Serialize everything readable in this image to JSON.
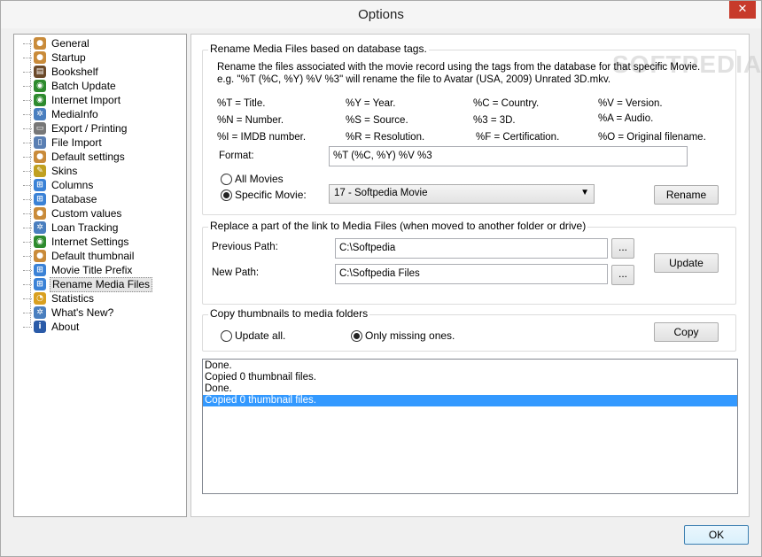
{
  "window": {
    "title": "Options",
    "close_glyph": "✕"
  },
  "watermark": "SOFTPEDIA",
  "sidebar": {
    "items": [
      {
        "label": "General",
        "icon": "person-icon",
        "color": "#c98b3a"
      },
      {
        "label": "Startup",
        "icon": "person-icon",
        "color": "#c98b3a"
      },
      {
        "label": "Bookshelf",
        "icon": "bookshelf-icon",
        "color": "#6b4a2a"
      },
      {
        "label": "Batch Update",
        "icon": "globe-icon",
        "color": "#2e8b2e"
      },
      {
        "label": "Internet Import",
        "icon": "globe-icon",
        "color": "#2e8b2e"
      },
      {
        "label": "MediaInfo",
        "icon": "gear-icon",
        "color": "#4a7fbf"
      },
      {
        "label": "Export / Printing",
        "icon": "printer-icon",
        "color": "#777777"
      },
      {
        "label": "File Import",
        "icon": "file-icon",
        "color": "#5a7fb3"
      },
      {
        "label": "Default settings",
        "icon": "person-icon",
        "color": "#c98b3a"
      },
      {
        "label": "Skins",
        "icon": "brush-icon",
        "color": "#c0a020"
      },
      {
        "label": "Columns",
        "icon": "windows-icon",
        "color": "#3b82d6"
      },
      {
        "label": "Database",
        "icon": "windows-icon",
        "color": "#3b82d6"
      },
      {
        "label": "Custom values",
        "icon": "person-icon",
        "color": "#c98b3a"
      },
      {
        "label": "Loan Tracking",
        "icon": "gear-icon",
        "color": "#4a7fbf"
      },
      {
        "label": "Internet Settings",
        "icon": "globe-icon",
        "color": "#2e8b2e"
      },
      {
        "label": "Default thumbnail",
        "icon": "person-icon",
        "color": "#c98b3a"
      },
      {
        "label": "Movie Title Prefix",
        "icon": "windows-icon",
        "color": "#3b82d6"
      },
      {
        "label": "Rename Media Files",
        "icon": "windows-icon",
        "color": "#3b82d6",
        "selected": true
      },
      {
        "label": "Statistics",
        "icon": "pie-chart-icon",
        "color": "#d9a020"
      },
      {
        "label": "What's New?",
        "icon": "gear-icon",
        "color": "#4a7fbf"
      },
      {
        "label": "About",
        "icon": "info-icon",
        "color": "#2a5ba8"
      }
    ]
  },
  "rename": {
    "group_title": "Rename Media Files based on database tags.",
    "desc1": "Rename the files associated with the movie record using the tags from the database for that specific Movie.",
    "desc2": "e.g. \"%T (%C, %Y) %V %3\" will rename the file to Avatar (USA, 2009) Unrated 3D.mkv.",
    "tags": [
      [
        "%T = Title.",
        "%Y = Year.",
        "%C = Country.",
        "%V = Version."
      ],
      [
        "%N = Number.",
        "%S = Source.",
        "%3 = 3D.",
        "%A = Audio."
      ],
      [
        "%I   = IMDB number.",
        "%R = Resolution.",
        "%F = Certification.",
        "%O = Original filename."
      ]
    ],
    "format_label": "Format:",
    "format_value": "%T (%C, %Y) %V %3",
    "all_movies_label": "All Movies",
    "specific_movie_label": "Specific Movie:",
    "specific_movie_value": "17 - Softpedia Movie",
    "rename_button": "Rename"
  },
  "replace": {
    "group_title": "Replace a part of the link to Media Files (when moved to another folder or drive)",
    "previous_label": "Previous Path:",
    "previous_value": "C:\\Softpedia",
    "new_label": "New Path:",
    "new_value": "C:\\Softpedia Files",
    "browse_label": "...",
    "update_button": "Update"
  },
  "copy": {
    "group_title": "Copy thumbnails to media folders",
    "update_all_label": "Update all.",
    "only_missing_label": "Only missing ones.",
    "copy_button": "Copy"
  },
  "log": {
    "lines": [
      "Done.",
      "Copied 0 thumbnail files.",
      "Done.",
      "Copied 0 thumbnail files."
    ]
  },
  "ok_button": "OK"
}
